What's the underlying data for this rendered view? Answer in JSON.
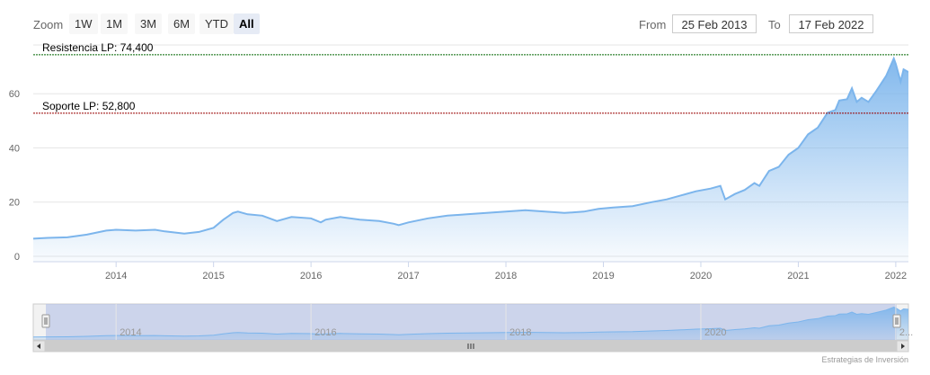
{
  "toolbar": {
    "zoom_label": "Zoom",
    "zoom_buttons": [
      "1W",
      "1M",
      "3M",
      "6M",
      "YTD",
      "All"
    ],
    "active_zoom": "All",
    "from_label": "From",
    "from_value": "25 Feb 2013",
    "to_label": "To",
    "to_value": "17 Feb 2022"
  },
  "chart_data": {
    "type": "area",
    "title": "",
    "xlabel": "",
    "ylabel": "",
    "x_ticks": [
      "2014",
      "2015",
      "2016",
      "2017",
      "2018",
      "2019",
      "2020",
      "2021",
      "2022"
    ],
    "y_ticks": [
      0,
      20,
      40,
      60
    ],
    "xlim": [
      2013.15,
      2022.13
    ],
    "ylim": [
      -2,
      78
    ],
    "grid": true,
    "series": [
      {
        "x": [
          2013.15,
          2013.3,
          2013.5,
          2013.7,
          2013.9,
          2014.0,
          2014.2,
          2014.4,
          2014.5,
          2014.7,
          2014.85,
          2015.0,
          2015.1,
          2015.2,
          2015.25,
          2015.35,
          2015.5,
          2015.65,
          2015.8,
          2016.0,
          2016.1,
          2016.15,
          2016.3,
          2016.5,
          2016.7,
          2016.85,
          2016.9,
          2017.0,
          2017.2,
          2017.4,
          2017.6,
          2017.8,
          2018.0,
          2018.2,
          2018.4,
          2018.6,
          2018.8,
          2018.95,
          2019.1,
          2019.3,
          2019.5,
          2019.65,
          2019.8,
          2019.95,
          2020.1,
          2020.2,
          2020.25,
          2020.35,
          2020.45,
          2020.55,
          2020.6,
          2020.7,
          2020.8,
          2020.9,
          2021.0,
          2021.1,
          2021.2,
          2021.3,
          2021.38,
          2021.42,
          2021.5,
          2021.55,
          2021.6,
          2021.65,
          2021.72,
          2021.8,
          2021.9,
          2021.98,
          2022.0,
          2022.05,
          2022.08,
          2022.13
        ],
        "y": [
          6.5,
          6.8,
          7.0,
          8.0,
          9.5,
          9.8,
          9.5,
          9.8,
          9.2,
          8.4,
          9.0,
          10.5,
          13.5,
          16.0,
          16.5,
          15.5,
          15.0,
          13.0,
          14.5,
          14.0,
          12.5,
          13.5,
          14.5,
          13.5,
          13.0,
          12.0,
          11.5,
          12.5,
          14.0,
          15.0,
          15.5,
          16.0,
          16.5,
          17.0,
          16.5,
          16.0,
          16.5,
          17.5,
          18.0,
          18.5,
          20.0,
          21.0,
          22.5,
          24.0,
          25.0,
          26.0,
          21.0,
          23.0,
          24.5,
          27.0,
          26.0,
          31.5,
          33.0,
          37.5,
          40.0,
          45.0,
          47.5,
          53.0,
          54.0,
          57.5,
          58.0,
          62.0,
          57.0,
          58.5,
          57.0,
          61.0,
          66.5,
          73.0,
          71.0,
          64.5,
          69.0,
          68.0
        ]
      }
    ],
    "plot_lines": [
      {
        "label": "Resistencia LP: 74,400",
        "value": 74.4,
        "color": "#006600"
      },
      {
        "label": "Soporte LP: 52,800",
        "value": 52.8,
        "color": "#990000"
      }
    ],
    "navigator_ticks": [
      "2014",
      "2016",
      "2018",
      "2020",
      "2..."
    ],
    "line_color": "#7cb5ec",
    "credits": "Estrategias de Inversión"
  }
}
